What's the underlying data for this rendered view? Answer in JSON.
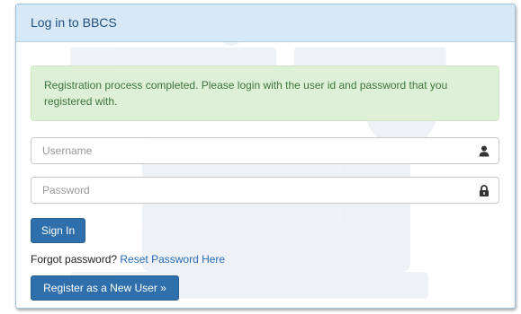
{
  "panel": {
    "title": "Log in to BBCS"
  },
  "alert": {
    "message": "Registration process completed. Please login with the user id and password that you registered with."
  },
  "username": {
    "placeholder": "Username",
    "value": "",
    "icon": "user-icon"
  },
  "password": {
    "placeholder": "Password",
    "value": "",
    "icon": "lock-icon"
  },
  "buttons": {
    "sign_in": "Sign In",
    "register": "Register as a New User »"
  },
  "forgot": {
    "prompt": "Forgot password?",
    "link": "Reset Password Here"
  },
  "colors": {
    "heading_bg": "#d7e9f6",
    "alert_bg": "#dff0d8",
    "alert_text": "#3c763d",
    "primary_button": "#2f6fab",
    "link": "#2a6db5"
  }
}
